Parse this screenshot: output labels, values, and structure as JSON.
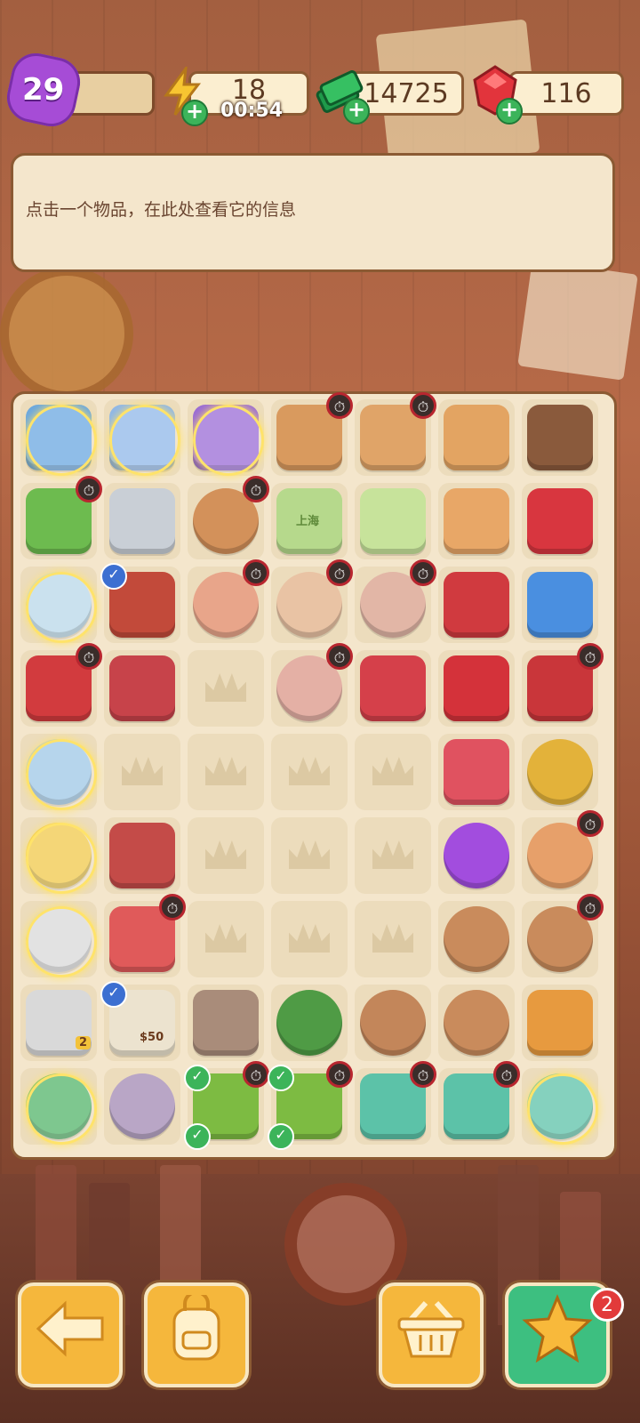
{
  "hud": {
    "level": "29",
    "xp_progress": 0.1,
    "energy": "18",
    "energy_timer": "00:54",
    "cash": "14725",
    "gems": "116"
  },
  "info_panel": {
    "text": "点击一个物品，在此处查看它的信息"
  },
  "board": {
    "rows": 9,
    "cols": 7,
    "cells": [
      [
        "blue-crate-vehicle",
        "gem-cart",
        "purple-gem-cart",
        "delivery-crate-locked",
        "open-box-locked",
        "cardboard-stack",
        "photo-wallet"
      ],
      [
        "green-plant-locked",
        "hand-saw",
        "wooden-box-vase-locked",
        "green-soap-bar",
        "green-melon-slice",
        "box-stack",
        "red-toolbox"
      ],
      [
        "glowing-jar",
        "tool-item-checked",
        "painted-vase-locked",
        "striped-vase-locked",
        "white-vase-locked",
        "red-tool-case",
        "blue-headphones"
      ],
      [
        "red-cart-locked",
        "garden-trowel",
        "empty",
        "clay-pot-locked",
        "red-tray",
        "red-gloves",
        "red-bag-locked"
      ],
      [
        "glowing-tablet",
        "empty",
        "empty",
        "empty",
        "empty",
        "white-gloves",
        "yellow-horseshoe"
      ],
      [
        "glowing-gold-chest",
        "garden-fork",
        "empty",
        "empty",
        "empty",
        "purple-star",
        "ornate-vase-locked"
      ],
      [
        "glowing-hexagon-plate",
        "flower-planter-locked",
        "empty",
        "empty",
        "empty",
        "broken-pot",
        "sprout-pot-locked"
      ],
      [
        "stone-bench",
        "price-poster-checked",
        "footprint-sample",
        "berry-bush",
        "cracked-clay-pot",
        "clay-pot",
        "ice-cream-bar"
      ],
      [
        "glowing-tree",
        "character-portrait",
        "bonsai-checked-locked",
        "bonsai-checked-locked",
        "medkit-locked",
        "medkit-locked",
        "medkit-glow"
      ]
    ],
    "price_tag": "$50",
    "bench_number": "2",
    "soap_text": "上海"
  },
  "buttons": {
    "back": "arrow-left-icon",
    "bag": "backpack-icon",
    "basket": "basket-icon",
    "star": "star-icon",
    "star_badge": "2"
  },
  "colors": {
    "board_bg": "#f4e6cc",
    "button_orange": "#f5b73c",
    "button_green": "#3dbf80",
    "level_purple": "#a64cd6"
  }
}
